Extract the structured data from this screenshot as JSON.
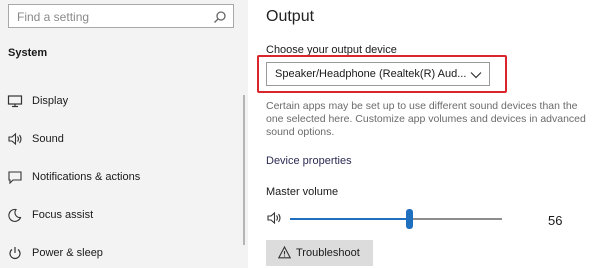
{
  "search": {
    "placeholder": "Find a setting"
  },
  "sidebar": {
    "section": "System",
    "items": [
      {
        "label": "Display",
        "icon": "display-icon"
      },
      {
        "label": "Sound",
        "icon": "speaker-icon"
      },
      {
        "label": "Notifications & actions",
        "icon": "notifications-icon"
      },
      {
        "label": "Focus assist",
        "icon": "moon-icon"
      },
      {
        "label": "Power & sleep",
        "icon": "power-icon"
      }
    ]
  },
  "main": {
    "title": "Output",
    "choose_label": "Choose your output device",
    "device_selected": "Speaker/Headphone (Realtek(R) Aud...",
    "description": "Certain apps may be set up to use different sound devices than the one selected here. Customize app volumes and devices in advanced sound options.",
    "device_properties_link": "Device properties",
    "master_volume_label": "Master volume",
    "volume_value": "56",
    "volume_level": 0.56,
    "troubleshoot_label": "Troubleshoot"
  },
  "colors": {
    "accent": "#1f6fbf",
    "highlight_border": "#d9262c"
  }
}
